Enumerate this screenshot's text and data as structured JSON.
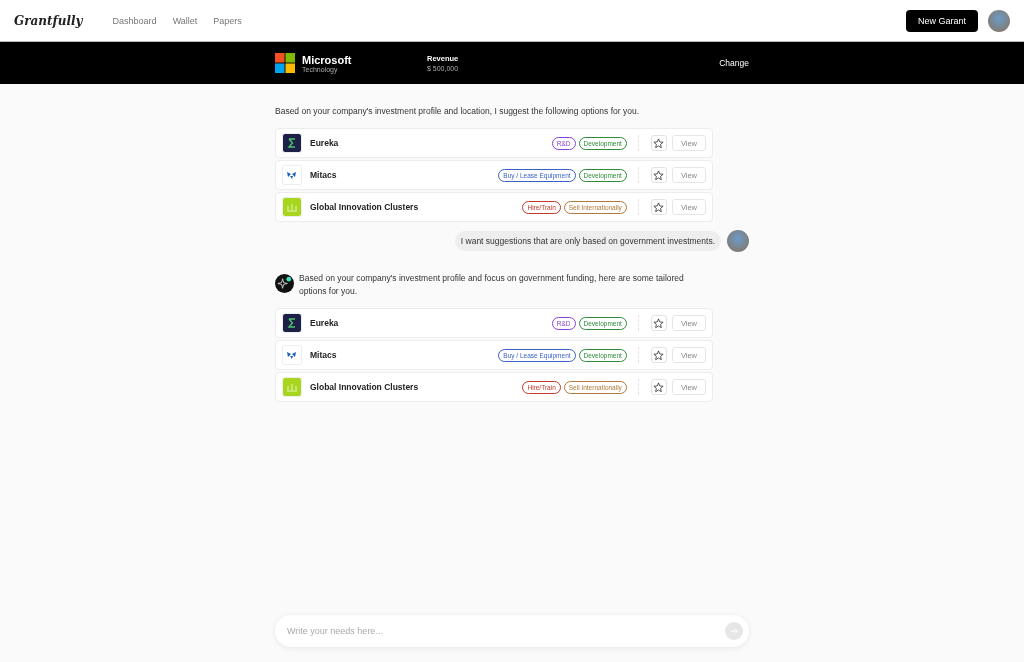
{
  "nav": {
    "logo": "Grantfully",
    "links": [
      {
        "label": "Dashboard",
        "selected": false
      },
      {
        "label": "Wallet",
        "selected": false
      },
      {
        "label": "Papers",
        "selected": false
      }
    ],
    "new_button": "New Garant"
  },
  "company": {
    "name": "Microsoft",
    "sector": "Technology",
    "revenue_label": "Revenue",
    "revenue": "$ 500,000",
    "change": "Change"
  },
  "messages": [
    {
      "kind": "assistant",
      "avatar": false,
      "text": "Based on your company's investment profile and location, I suggest the following options for you.",
      "options": [
        {
          "kind": "sigma",
          "name": "Eureka",
          "starred": false,
          "view": "View",
          "tags": [
            {
              "label": "R&D",
              "color": "#8b3fd9"
            },
            {
              "label": "Development",
              "color": "#2e8b3a"
            }
          ]
        },
        {
          "kind": "fan",
          "name": "Mitacs",
          "starred": false,
          "view": "View",
          "tags": [
            {
              "label": "Buy / Lease Equipment",
              "color": "#3a62c4"
            },
            {
              "label": "Development",
              "color": "#2e8b3a"
            }
          ]
        },
        {
          "kind": "crown",
          "name": "Global Innovation Clusters",
          "starred": false,
          "view": "View",
          "tags": [
            {
              "label": "Hire/Train",
              "color": "#c0392b"
            },
            {
              "label": "Sell Internationally",
              "color": "#b07a3a"
            }
          ]
        }
      ]
    },
    {
      "kind": "user",
      "text": "I want suggestions that are only based on government investments."
    },
    {
      "kind": "assistant",
      "avatar": true,
      "text": "Based on your company's investment profile and focus on government funding, here are some tailored options for you.",
      "options": [
        {
          "kind": "sigma",
          "name": "Eureka",
          "starred": false,
          "view": "View",
          "tags": [
            {
              "label": "R&D",
              "color": "#8b3fd9"
            },
            {
              "label": "Development",
              "color": "#2e8b3a"
            }
          ]
        },
        {
          "kind": "fan",
          "name": "Mitacs",
          "starred": false,
          "view": "View",
          "tags": [
            {
              "label": "Buy / Lease Equipment",
              "color": "#3a62c4"
            },
            {
              "label": "Development",
              "color": "#2e8b3a"
            }
          ]
        },
        {
          "kind": "crown",
          "name": "Global Innovation Clusters",
          "starred": false,
          "view": "View",
          "tags": [
            {
              "label": "Hire/Train",
              "color": "#c0392b"
            },
            {
              "label": "Sell Internationally",
              "color": "#b07a3a"
            }
          ]
        }
      ]
    }
  ],
  "composer": {
    "placeholder": "Write your needs here..."
  }
}
